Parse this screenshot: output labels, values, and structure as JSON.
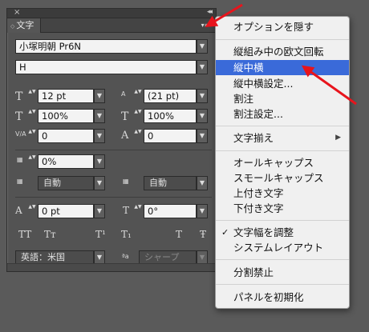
{
  "panel": {
    "close_glyph": "×",
    "collapse_glyph": "◂◂",
    "tab_label": "文字",
    "tab_arrows_glyph": "◇",
    "menu_button_glyph": "▾≡",
    "font_family": "小塚明朝 Pr6N",
    "font_style": "H",
    "font_size": "12 pt",
    "leading": "(21 pt)",
    "vertical_scale": "100%",
    "horizontal_scale": "100%",
    "tracking_left": "0",
    "tracking_right": "0",
    "tsume": "0%",
    "aki_left": "自動",
    "aki_right": "自動",
    "baseline_shift": "0 pt",
    "rotation": "0°",
    "language": "英語：米国",
    "antialias": "シャープ",
    "dropdown_glyph": "▼",
    "stepper_glyph": "▲▼",
    "icons": {
      "font_size": "T",
      "leading": "A",
      "vertical_scale": "T",
      "horizontal_scale": "T",
      "tracking": "V/A",
      "kerning": "A",
      "tsume": "▦",
      "aki_left": "▦",
      "aki_right": "▦",
      "baseline_shift": "A",
      "rotation": "T",
      "all_caps": "TT",
      "small_caps": "Tт",
      "superscript": "T¹",
      "subscript": "T₁",
      "underline": "T",
      "strikethrough": "Ŧ",
      "antialias": "ªa"
    }
  },
  "menu": {
    "items": [
      {
        "label": "オプションを隠す"
      },
      {
        "label": "縦組み中の欧文回転"
      },
      {
        "label": "縦中横"
      },
      {
        "label": "縦中横設定..."
      },
      {
        "label": "割注"
      },
      {
        "label": "割注設定..."
      },
      {
        "label": "文字揃え"
      },
      {
        "label": "オールキャップス"
      },
      {
        "label": "スモールキャップス"
      },
      {
        "label": "上付き文字"
      },
      {
        "label": "下付き文字"
      },
      {
        "label": "文字幅を調整"
      },
      {
        "label": "システムレイアウト"
      },
      {
        "label": "分割禁止"
      },
      {
        "label": "パネルを初期化"
      }
    ],
    "submenu_arrow": "▶",
    "check_glyph": "✓"
  },
  "colors": {
    "highlight": "#3a6ad9",
    "annotation_arrow": "#e8141c"
  }
}
